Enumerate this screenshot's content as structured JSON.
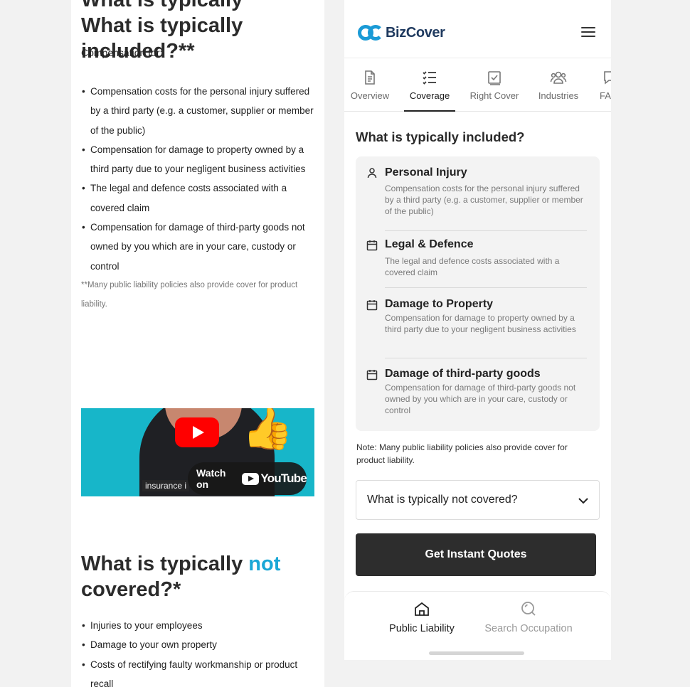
{
  "left_page": {
    "heading_included": "What is typically included?**",
    "compensation_for": "Compensation for:",
    "included_items": [
      "Compensation costs for the personal injury suffered by a third party (e.g. a customer, supplier or member of the public)",
      "Compensation for damage to property owned by a third party due to your negligent business activities",
      "The legal and defence costs associated with a covered claim",
      "Compensation for damage of third-party goods not owned by you which are in your care, custody or control"
    ],
    "footnote": "**Many public liability policies also provide cover for product liability.",
    "video": {
      "caption": "insurance i",
      "watch_label": "Watch on",
      "youtube_word": "YouTube"
    },
    "heading_not_pre": "What is typically ",
    "heading_not_accent": "not",
    "heading_not_post": " covered?*",
    "not_covered_items": [
      "Injuries to your employees",
      "Damage to your own property",
      "Costs of rectifying faulty workmanship or product recall"
    ]
  },
  "app": {
    "logo_text": "BizCover",
    "tabs": [
      {
        "label": "Overview",
        "icon": "document-icon"
      },
      {
        "label": "Coverage",
        "icon": "checklist-icon",
        "active": true
      },
      {
        "label": "Right Cover",
        "icon": "checkbox-icon"
      },
      {
        "label": "Industries",
        "icon": "people-icon"
      },
      {
        "label": "FAQ",
        "icon": "chat-icon"
      }
    ],
    "included_title": "What is typically included?",
    "included_items": [
      {
        "title": "Personal Injury",
        "icon": "person-icon",
        "desc": "Compensation costs for the personal injury suffered by a third party (e.g. a customer, supplier or member of the public)"
      },
      {
        "title": "Legal & Defence",
        "icon": "calendar-icon",
        "desc": "The legal and defence costs associated with a covered claim"
      },
      {
        "title": "Damage to Property",
        "icon": "calendar-icon",
        "desc": "Compensation for damage to property owned by a third party due to your negligent business activities"
      },
      {
        "title": "Damage of third-party goods",
        "icon": "calendar-icon",
        "desc": "Compensation for damage of third-party goods not owned by you which are in your care, custody or control"
      }
    ],
    "note": "Note: Many public liability policies also provide cover for product liability.",
    "not_covered_label": "What is typically not covered?",
    "cta_label": "Get Instant Quotes",
    "bottom_nav": [
      {
        "label": "Public Liability",
        "icon": "home-icon",
        "active": true
      },
      {
        "label": "Search Occupation",
        "icon": "search-icon",
        "active": false
      }
    ]
  }
}
